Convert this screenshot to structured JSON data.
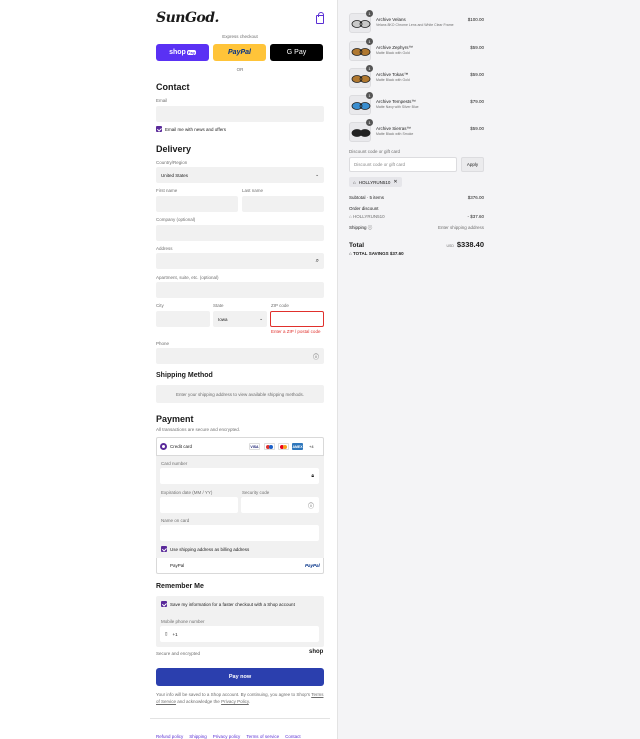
{
  "brand": {
    "logo": "SunGod."
  },
  "express": {
    "label": "Express checkout",
    "or": "OR",
    "shop_pay": "shop",
    "shop_pay_badge": "Pay",
    "paypal": "PayPal",
    "gpay": "G Pay"
  },
  "contact": {
    "heading": "Contact",
    "email_label": "Email",
    "newsletter": "Email me with news and offers"
  },
  "delivery": {
    "heading": "Delivery",
    "country_label": "Country/Region",
    "country": "United States",
    "first_name": "First name",
    "last_name": "Last name",
    "company": "Company (optional)",
    "address": "Address",
    "apartment": "Apartment, suite, etc. (optional)",
    "city": "City",
    "state_label": "State",
    "state": "Iowa",
    "zip": "ZIP code",
    "zip_error": "Enter a ZIP / postal code",
    "phone": "Phone"
  },
  "shipping": {
    "heading": "Shipping Method",
    "info": "Enter your shipping address to view available shipping methods."
  },
  "payment": {
    "heading": "Payment",
    "secure": "All transactions are secure and encrypted.",
    "credit_card": "Credit card",
    "card_more": "+4",
    "card_number": "Card number",
    "expiration": "Expiration date (MM / YY)",
    "security": "Security code",
    "name_on_card": "Name on card",
    "billing_same": "Use shipping address as billing address",
    "paypal": "PayPal",
    "paypal_logo": "PayPal",
    "card_brands": [
      "VISA",
      "MC",
      "MC",
      "AMEX"
    ]
  },
  "remember": {
    "heading": "Remember Me",
    "save": "Save my information for a faster checkout with a Shop account",
    "mobile_label": "Mobile phone number",
    "mobile_value": "+1",
    "secure": "Secure and encrypted",
    "shop": "shop"
  },
  "pay_now": "Pay now",
  "legal": {
    "line1": "Your info will be saved to a Shop account. By continuing, you agree to Shop's",
    "terms": "Terms of Service",
    "line2": "and acknowledge the",
    "privacy": "Privacy Policy",
    "end": "."
  },
  "footer": [
    "Refund policy",
    "Shipping",
    "Privacy policy",
    "Terms of service",
    "Contact"
  ],
  "items": [
    {
      "qty": "1",
      "name": "Archive Velans",
      "sub": "Velans 8KO Chrome Lens and White Clear Frame",
      "price": "$100.00",
      "color": "#c9c9c9"
    },
    {
      "qty": "1",
      "name": "Archive Zephyrs™",
      "sub": "Matte Black with Gold",
      "price": "$59.00",
      "color": "#b07830"
    },
    {
      "qty": "1",
      "name": "Archive Tokas™",
      "sub": "Matte Black with Gold",
      "price": "$59.00",
      "color": "#b07830"
    },
    {
      "qty": "1",
      "name": "Archive Tempests™",
      "sub": "Matte Navy with Silver Blue",
      "price": "$79.00",
      "color": "#3a8ed0"
    },
    {
      "qty": "1",
      "name": "Archive Sierras™",
      "sub": "Matte Black with Smoke",
      "price": "$59.00",
      "color": "#222222"
    }
  ],
  "discount": {
    "label": "Discount code or gift card",
    "placeholder": "Discount code or gift card",
    "apply": "Apply",
    "code": "HOLLYRUN510"
  },
  "summary": {
    "subtotal_label": "Subtotal · 5 items",
    "subtotal": "$376.00",
    "order_discount": "Order discount",
    "code": "HOLLYRUN510",
    "discount_value": "- $37.60",
    "shipping_label": "Shipping",
    "shipping_value": "Enter shipping address",
    "total_label": "Total",
    "currency": "USD",
    "total": "$338.40",
    "savings_label": "TOTAL SAVINGS",
    "savings": "$37.60"
  }
}
